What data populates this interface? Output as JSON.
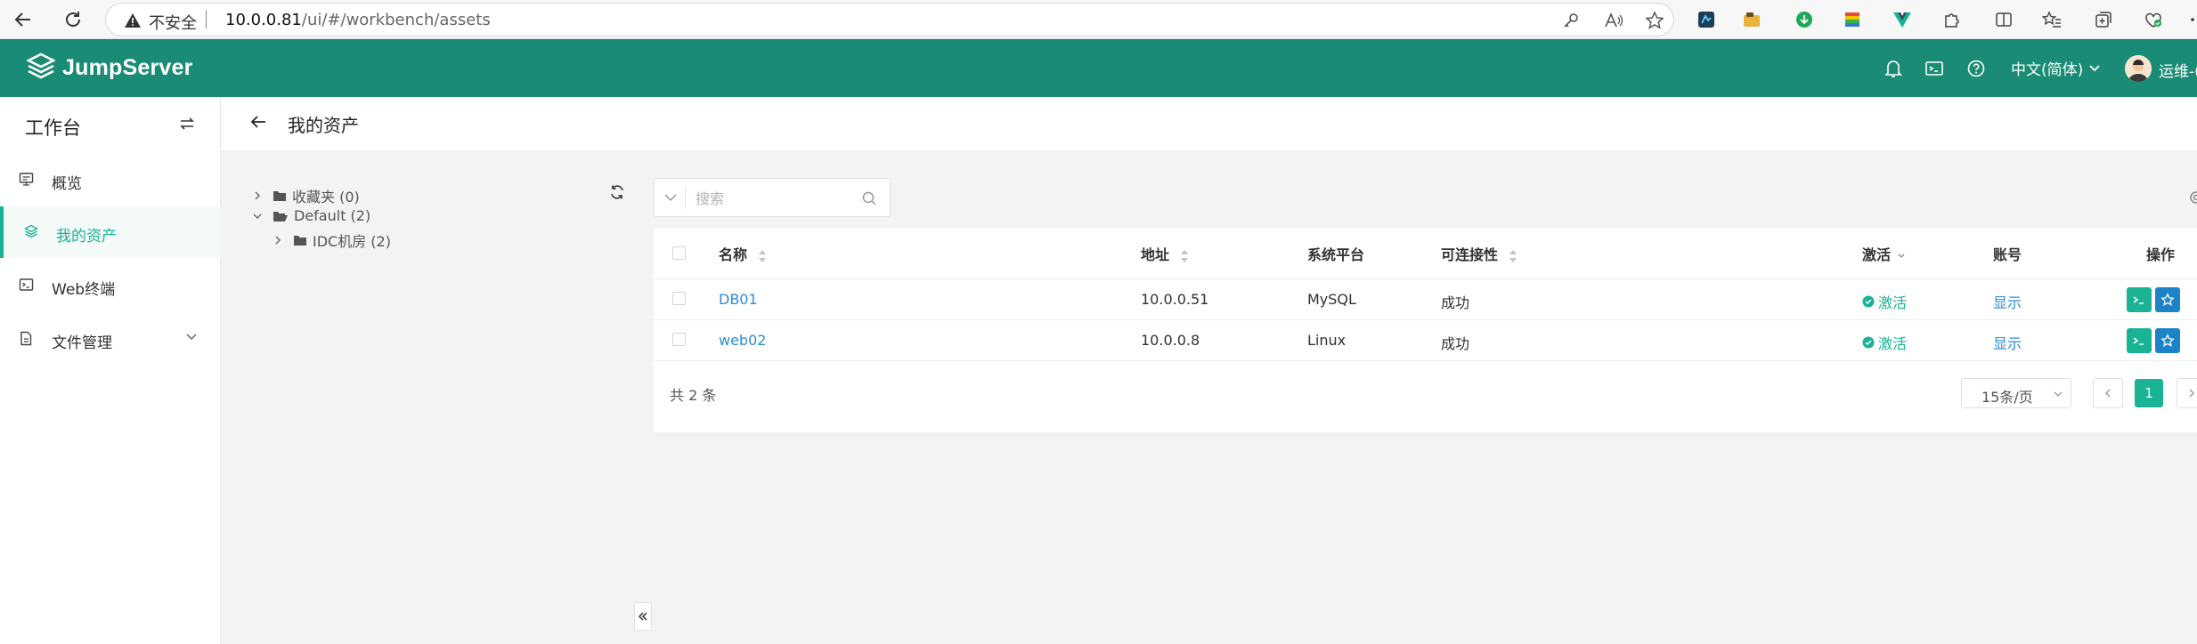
{
  "browser": {
    "insecure_label": "不安全",
    "url_host": "10.0.0.81",
    "url_path": "/ui/#/workbench/assets"
  },
  "header": {
    "logo_text": "JumpServer",
    "language": "中文(简体)",
    "user_name": "运维-(",
    "brand_color": "#1a8b75"
  },
  "sidebar": {
    "title": "工作台",
    "items": [
      {
        "label": "概览",
        "icon": "monitor-icon"
      },
      {
        "label": "我的资产",
        "icon": "layers-icon",
        "active": true
      },
      {
        "label": "Web终端",
        "icon": "terminal-icon"
      },
      {
        "label": "文件管理",
        "icon": "file-icon"
      }
    ]
  },
  "page": {
    "title": "我的资产"
  },
  "tree": {
    "favorites": "收藏夹 (0)",
    "default": "Default (2)",
    "idc": "IDC机房 (2)"
  },
  "search": {
    "placeholder": "搜索"
  },
  "table": {
    "headers": {
      "name": "名称",
      "address": "地址",
      "platform": "系统平台",
      "connectivity": "可连接性",
      "active": "激活",
      "account": "账号",
      "actions": "操作"
    },
    "rows": [
      {
        "name": "DB01",
        "address": "10.0.0.51",
        "platform": "MySQL",
        "connectivity": "成功",
        "active": "激活",
        "account": "显示"
      },
      {
        "name": "web02",
        "address": "10.0.0.8",
        "platform": "Linux",
        "connectivity": "成功",
        "active": "激活",
        "account": "显示"
      }
    ]
  },
  "pagination": {
    "total": "共 2 条",
    "page_size": "15条/页",
    "current_page": "1"
  }
}
